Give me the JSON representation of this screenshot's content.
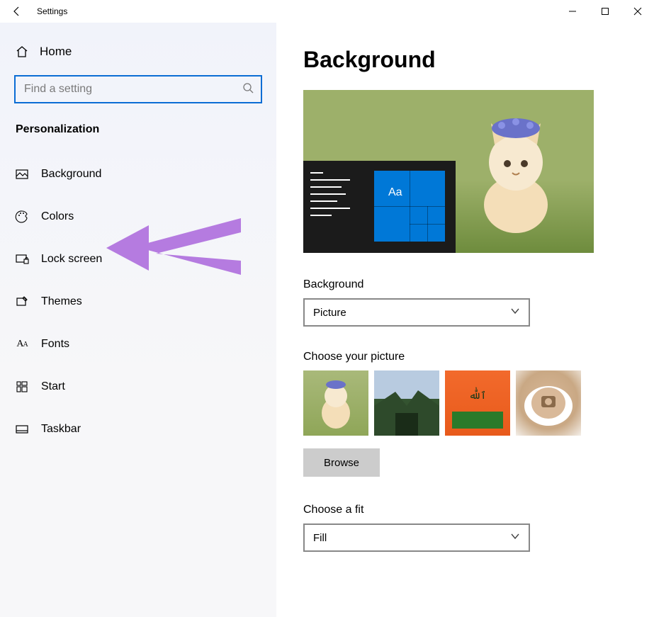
{
  "window": {
    "title": "Settings"
  },
  "sidebar": {
    "home_label": "Home",
    "search_placeholder": "Find a setting",
    "section_label": "Personalization",
    "items": [
      {
        "label": "Background"
      },
      {
        "label": "Colors"
      },
      {
        "label": "Lock screen"
      },
      {
        "label": "Themes"
      },
      {
        "label": "Fonts"
      },
      {
        "label": "Start"
      },
      {
        "label": "Taskbar"
      }
    ]
  },
  "content": {
    "heading": "Background",
    "preview_tile_text": "Aa",
    "background_label": "Background",
    "background_value": "Picture",
    "choose_picture_label": "Choose your picture",
    "browse_label": "Browse",
    "choose_fit_label": "Choose a fit",
    "fit_value": "Fill"
  }
}
